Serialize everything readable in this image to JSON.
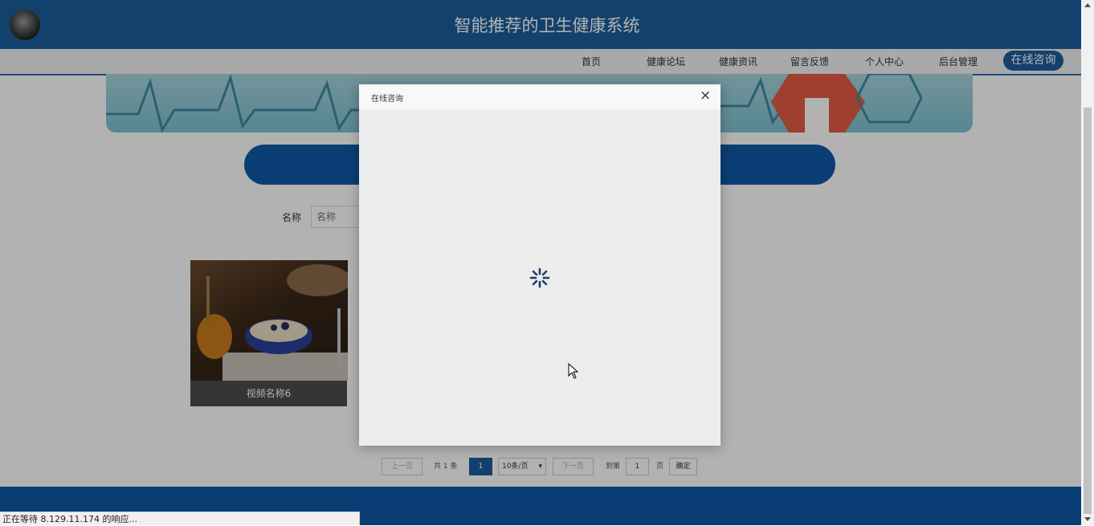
{
  "header": {
    "title": "智能推荐的卫生健康系统"
  },
  "nav": {
    "items": [
      {
        "label": "首页"
      },
      {
        "label": "健康论坛"
      },
      {
        "label": "健康资讯"
      },
      {
        "label": "留言反馈"
      },
      {
        "label": "个人中心"
      },
      {
        "label": "后台管理"
      }
    ],
    "active": "在线咨询"
  },
  "search": {
    "label": "名称",
    "placeholder": "名称"
  },
  "cards": [
    {
      "caption": "视频名称6"
    }
  ],
  "pagination": {
    "prev": "上一页",
    "total": "共 1 条",
    "current": "1",
    "per_page_selected": "10条/页",
    "next": "下一页",
    "goto_prefix": "到第",
    "goto_value": "1",
    "goto_suffix": "页",
    "confirm": "确定"
  },
  "dialog": {
    "title": "在线咨询",
    "close": "×",
    "loading_icon": "spinner-icon"
  },
  "status_bar": {
    "text": "正在等待 8.129.11.174 的响应..."
  },
  "colors": {
    "primary": "#1c5e9c",
    "search_pill": "#0f5aa8",
    "footer": "#0f5aa8"
  }
}
